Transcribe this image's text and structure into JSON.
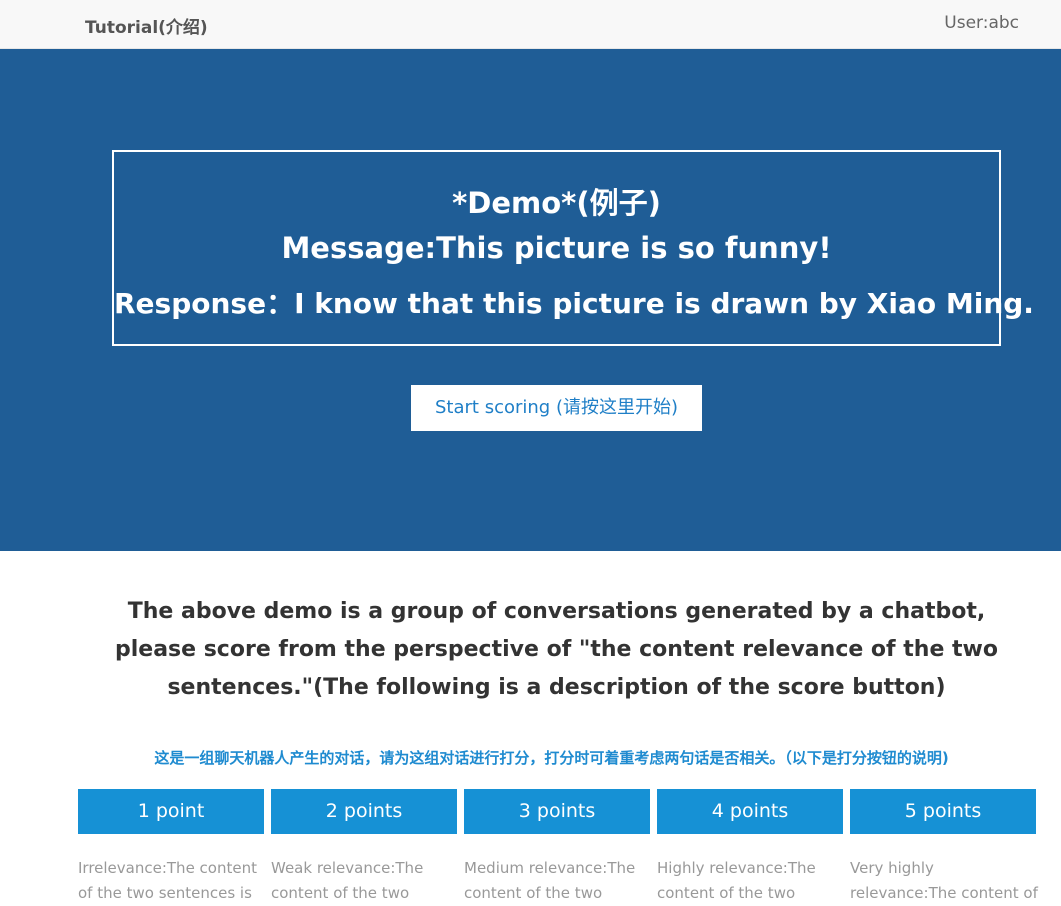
{
  "navbar": {
    "brand": "Tutorial(介绍)",
    "user": "User:abc"
  },
  "demo": {
    "title": "*Demo*(例子)",
    "message": "Message:This picture is so funny!",
    "response": "Response：I know that this picture is drawn by Xiao Ming."
  },
  "start_button": "Start scoring (请按这里开始)",
  "description": {
    "english": "The above demo is a group of conversations generated by a chatbot, please score from the perspective of \"the content relevance of the two sentences.\"(The following is a description of the score button)",
    "chinese": "这是一组聊天机器人产生的对话，请为这组对话进行打分，打分时可着重考虑两句话是否相关。（以下是打分按钮的说明)"
  },
  "scores": [
    {
      "label": "1 point",
      "description": "Irrelevance:The content of the two sentences is"
    },
    {
      "label": "2 points",
      "description": "Weak relevance:The content of the two"
    },
    {
      "label": "3 points",
      "description": "Medium relevance:The content of the two"
    },
    {
      "label": "4 points",
      "description": "Highly relevance:The content of the two"
    },
    {
      "label": "5 points",
      "description": "Very highly relevance:The content of the two"
    }
  ],
  "colors": {
    "hero_background": "#1f5d96",
    "score_button": "#1691d5",
    "accent_text": "#1f8bd0"
  }
}
